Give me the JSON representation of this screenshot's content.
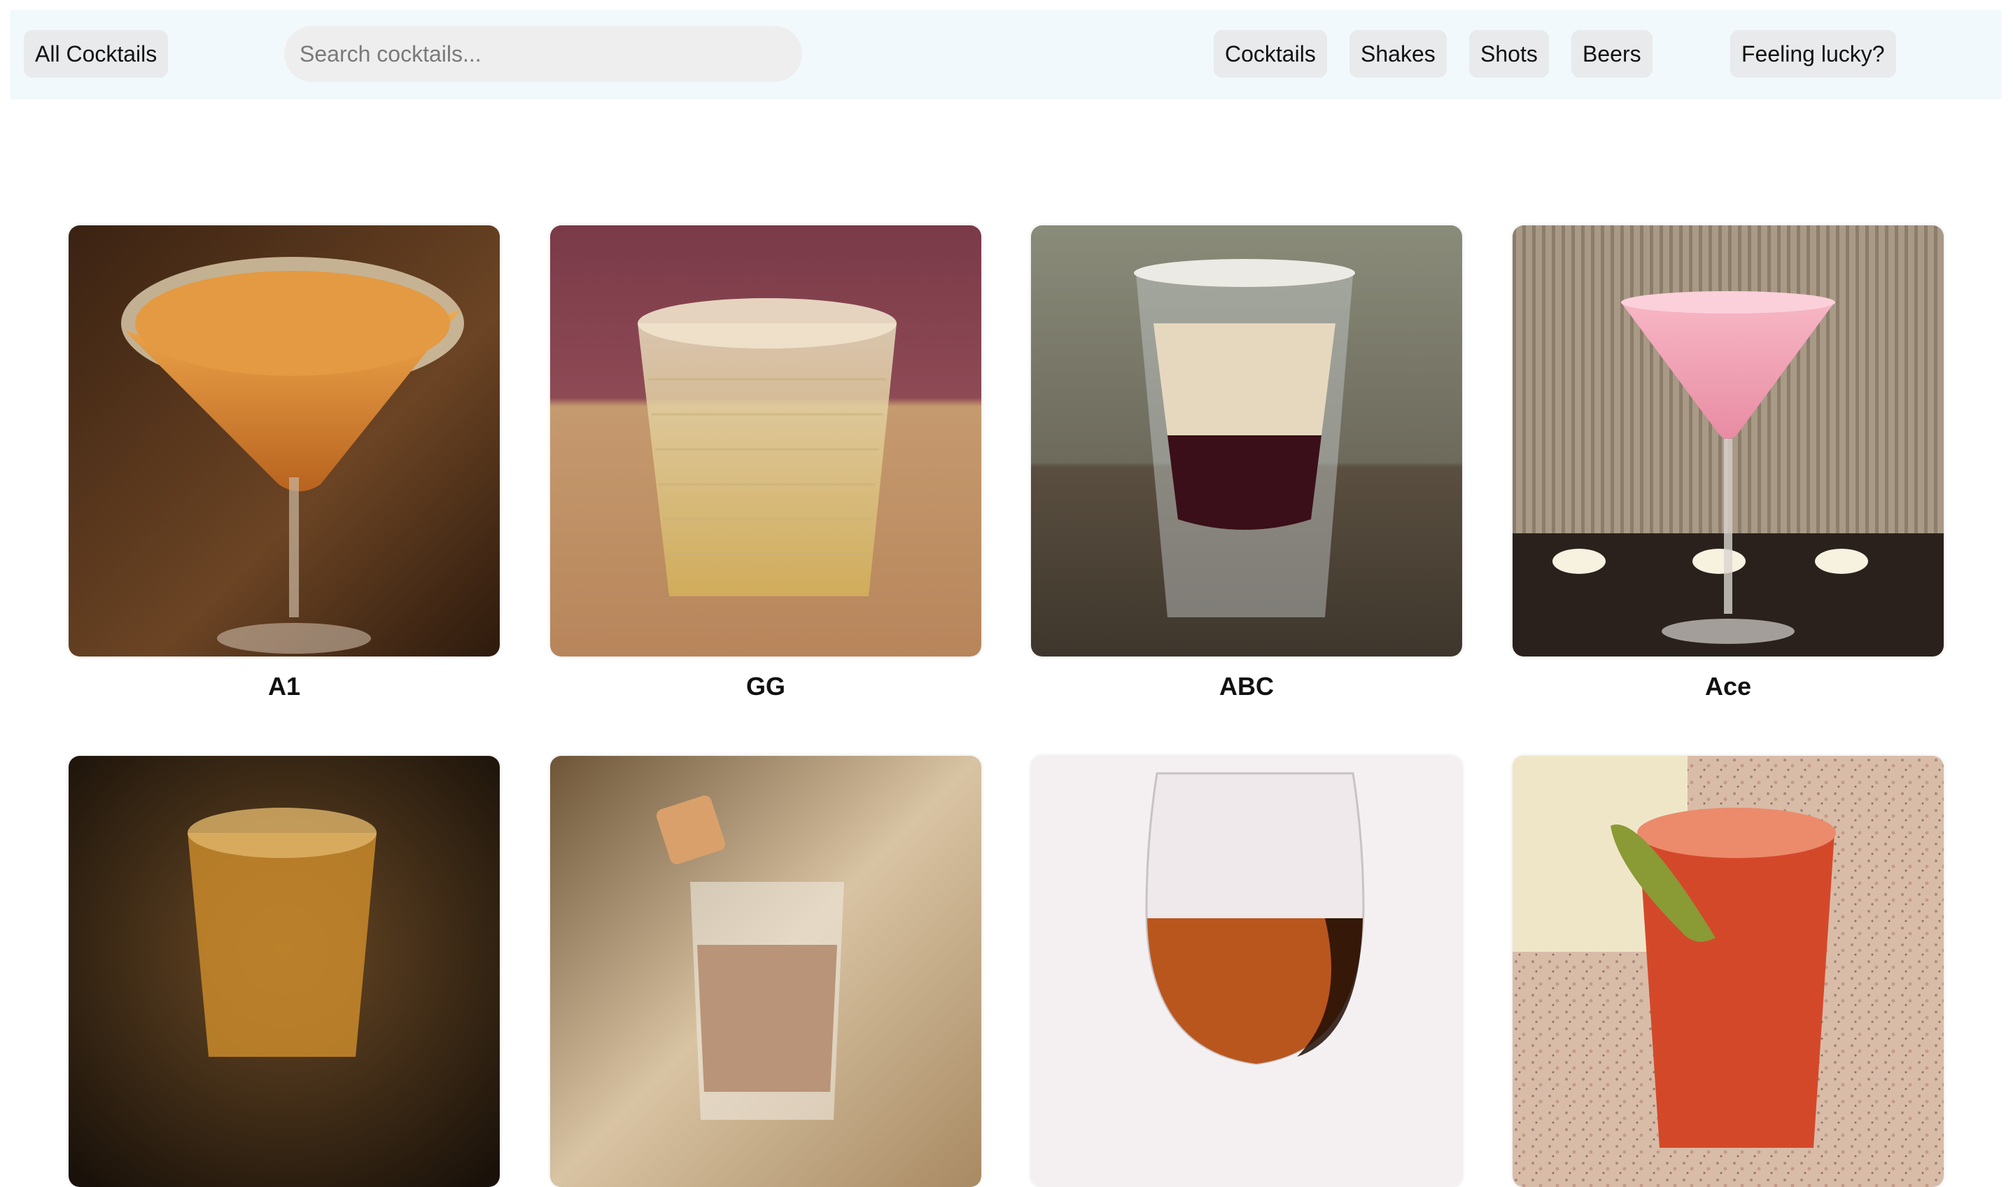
{
  "nav": {
    "all_label": "All Cocktails",
    "search_placeholder": "Search cocktails...",
    "categories": [
      "Cocktails",
      "Shakes",
      "Shots",
      "Beers"
    ],
    "lucky_label": "Feeling lucky?"
  },
  "drinks": [
    {
      "name": "A1",
      "image": "amber martini with sugar rim"
    },
    {
      "name": "GG",
      "image": "textured tumbler with pale drink"
    },
    {
      "name": "ABC",
      "image": "layered shot glass"
    },
    {
      "name": "Ace",
      "image": "pink martini with candles"
    },
    {
      "name": "",
      "image": "amber shot glass on wood"
    },
    {
      "name": "",
      "image": "cream shot with caramel skewer"
    },
    {
      "name": "",
      "image": "wine glass with amber liquid"
    },
    {
      "name": "",
      "image": "red cocktail with okra garnish"
    }
  ],
  "colors": {
    "navbar_bg": "#f2f9fc",
    "pill_bg": "#e8eaeb",
    "search_bg": "#eeeeee"
  }
}
